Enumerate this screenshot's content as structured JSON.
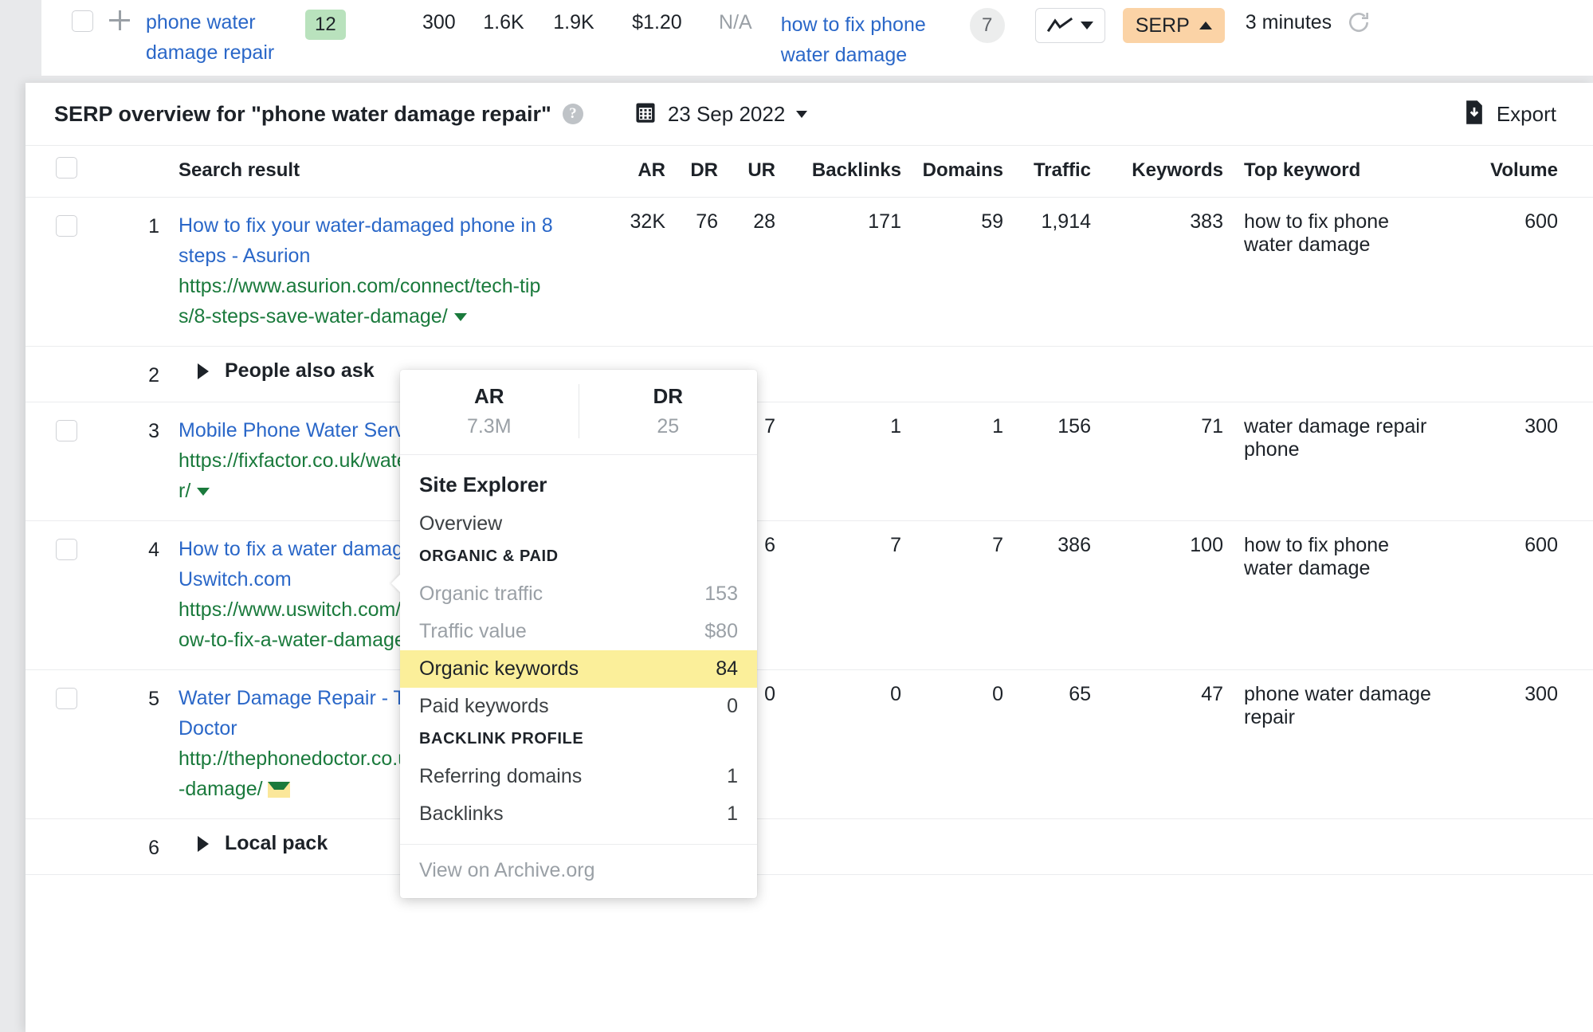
{
  "keyword_row": {
    "keyword": "phone water damage repair",
    "position_badge": "12",
    "volume": "300",
    "kd": "1.6K",
    "traffic_potential": "1.9K",
    "cpc": "$1.20",
    "na": "N/A",
    "top_keyword": "how to fix phone water damage",
    "count_circle": "7",
    "serp_button": "SERP",
    "updated": "3 minutes",
    "icons": {
      "checkbox": "checkbox-icon",
      "plus": "plus-icon",
      "chart": "line-chart-icon",
      "caret_down": "chevron-down-icon",
      "caret_up": "chevron-up-icon",
      "refresh": "refresh-icon"
    }
  },
  "panel": {
    "title": "SERP overview for \"phone water damage repair\"",
    "help_glyph": "?",
    "date": "23 Sep 2022",
    "export_label": "Export",
    "icons": {
      "calendar": "calendar-icon",
      "download": "download-icon",
      "help": "help-icon"
    }
  },
  "table": {
    "columns": [
      "Search result",
      "AR",
      "DR",
      "UR",
      "Backlinks",
      "Domains",
      "Traffic",
      "Keywords",
      "Top keyword",
      "Volume"
    ],
    "rows": [
      {
        "type": "result",
        "num": "1",
        "title": "How to fix your water-damaged phone in 8 steps - Asurion",
        "url": "https://www.asurion.com/connect/tech-tips/8-steps-save-water-damage/",
        "ar": "32K",
        "dr": "76",
        "ur": "28",
        "backlinks": "171",
        "domains": "59",
        "traffic": "1,914",
        "keywords": "383",
        "top_keyword": "how to fix phone water damage",
        "volume": "600"
      },
      {
        "type": "feature",
        "num": "2",
        "label": "People also ask"
      },
      {
        "type": "result",
        "num": "3",
        "title": "Mobile Phone Water Service - Fixfactor",
        "url": "https://fixfactor.co.uk/water-damage-repair/",
        "ar": "",
        "dr": "",
        "ur": "7",
        "backlinks": "1",
        "domains": "1",
        "traffic": "156",
        "keywords": "71",
        "top_keyword": "water damage repair phone",
        "volume": "300"
      },
      {
        "type": "result",
        "num": "4",
        "title": "How to fix a water damaged phone - Uswitch.com",
        "url": "https://www.uswitch.com/mobiles/guides/how-to-fix-a-water-damaged-phone/",
        "ar": "",
        "dr": "",
        "ur": "6",
        "backlinks": "7",
        "domains": "7",
        "traffic": "386",
        "keywords": "100",
        "top_keyword": "how to fix phone water damage",
        "volume": "600"
      },
      {
        "type": "result",
        "num": "5",
        "title": "Water Damage Repair - The Phone Doctor",
        "url": "http://thephonedoctor.co.uk/services/water-damage/",
        "ar": "",
        "dr": "",
        "ur": "0",
        "backlinks": "0",
        "domains": "0",
        "traffic": "65",
        "keywords": "47",
        "top_keyword": "phone water damage repair",
        "volume": "300"
      },
      {
        "type": "feature",
        "num": "6",
        "label": "Local pack"
      }
    ]
  },
  "popup": {
    "metrics": [
      {
        "label": "AR",
        "value": "7.3M"
      },
      {
        "label": "DR",
        "value": "25"
      }
    ],
    "section_title": "Site Explorer",
    "overview_link": "Overview",
    "organic_header": "ORGANIC & PAID",
    "organic_items": [
      {
        "label": "Organic traffic",
        "value": "153",
        "highlight": false
      },
      {
        "label": "Traffic value",
        "value": "$80",
        "highlight": false
      },
      {
        "label": "Organic keywords",
        "value": "84",
        "highlight": true
      },
      {
        "label": "Paid keywords",
        "value": "0",
        "highlight": false
      }
    ],
    "backlink_header": "BACKLINK PROFILE",
    "backlink_items": [
      {
        "label": "Referring domains",
        "value": "1"
      },
      {
        "label": "Backlinks",
        "value": "1"
      }
    ],
    "footer_link": "View on Archive.org"
  },
  "colors": {
    "link": "#2a67c8",
    "url_green": "#1a7a3c",
    "badge_green": "#b9e2bd",
    "serp_orange": "#fbd3a6",
    "highlight_yellow": "#fbef9a"
  }
}
